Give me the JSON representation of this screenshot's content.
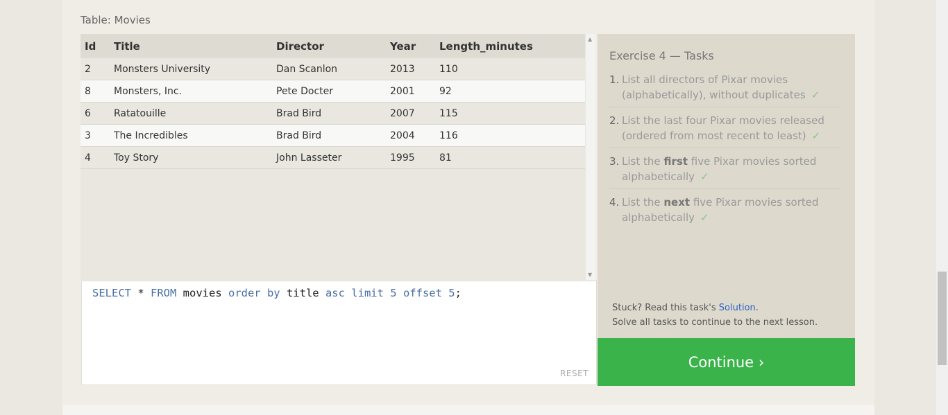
{
  "table_caption": "Table: Movies",
  "columns": [
    "Id",
    "Title",
    "Director",
    "Year",
    "Length_minutes"
  ],
  "rows": [
    {
      "id": "2",
      "title": "Monsters University",
      "director": "Dan Scanlon",
      "year": "2013",
      "length": "110"
    },
    {
      "id": "8",
      "title": "Monsters, Inc.",
      "director": "Pete Docter",
      "year": "2001",
      "length": "92"
    },
    {
      "id": "6",
      "title": "Ratatouille",
      "director": "Brad Bird",
      "year": "2007",
      "length": "115"
    },
    {
      "id": "3",
      "title": "The Incredibles",
      "director": "Brad Bird",
      "year": "2004",
      "length": "116"
    },
    {
      "id": "4",
      "title": "Toy Story",
      "director": "John Lasseter",
      "year": "1995",
      "length": "81"
    }
  ],
  "editor": {
    "query_tokens": {
      "select": "SELECT",
      "star": " * ",
      "from": "FROM",
      "table": " movies ",
      "order_by": "order by",
      "column": " title ",
      "asc": "asc",
      "limit": " limit ",
      "limit_value": "5",
      "offset": " offset ",
      "offset_value": "5",
      "end": ";"
    },
    "reset_label": "RESET"
  },
  "tasks": {
    "title": "Exercise 4 — Tasks",
    "items": [
      {
        "num": "1.",
        "pre": "List all directors of Pixar movies (alphabetically), without duplicates",
        "bold": "",
        "post": "",
        "check": "✓"
      },
      {
        "num": "2.",
        "pre": "List the last four Pixar movies released (ordered from most recent to least)",
        "bold": "",
        "post": "",
        "check": "✓"
      },
      {
        "num": "3.",
        "pre": "List the ",
        "bold": "first",
        "post": " five Pixar movies sorted alphabetically",
        "check": "✓"
      },
      {
        "num": "4.",
        "pre": "List the ",
        "bold": "next",
        "post": " five Pixar movies sorted alphabetically",
        "check": "✓"
      }
    ],
    "stuck_prefix": "Stuck? Read this task's ",
    "solution_link": "Solution",
    "stuck_suffix": ".",
    "solve_note": "Solve all tasks to continue to the next lesson."
  },
  "continue_label": "Continue ›",
  "colors": {
    "accent_green": "#3ab34a",
    "link_blue": "#2e63c5",
    "check_green": "#8bc48b"
  }
}
